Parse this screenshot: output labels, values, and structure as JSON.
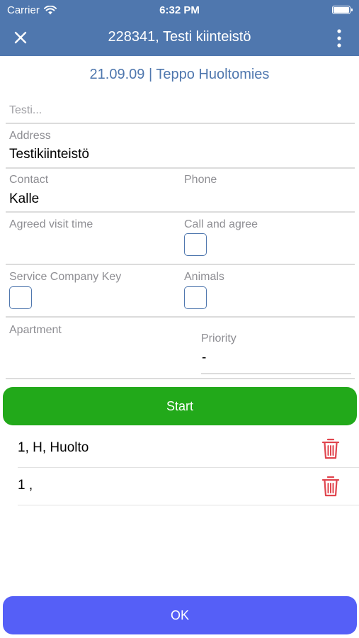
{
  "status_bar": {
    "carrier": "Carrier",
    "time": "6:32 PM"
  },
  "nav": {
    "title": "228341, Testi kiinteistö"
  },
  "subheader": "21.09.09 | Teppo Huoltomies",
  "form": {
    "description_placeholder": "Testi...",
    "address_label": "Address",
    "address_value": "Testikiinteistö",
    "contact_label": "Contact",
    "contact_value": "Kalle",
    "phone_label": "Phone",
    "phone_value": "",
    "agreed_visit_time_label": "Agreed visit time",
    "call_and_agree_label": "Call and agree",
    "service_company_key_label": "Service Company Key",
    "animals_label": "Animals",
    "apartment_label": "Apartment",
    "priority_label": "Priority",
    "priority_value": "-"
  },
  "start_label": "Start",
  "tasks": [
    {
      "text": "1, H, Huolto"
    },
    {
      "text": "1 ,"
    }
  ],
  "ok_label": "OK",
  "colors": {
    "header": "#4f77ae",
    "start": "#22a91a",
    "ok": "#555ff7",
    "trash": "#e0454e"
  },
  "icons": [
    "wifi-icon",
    "battery-icon",
    "close-icon",
    "more-vertical-icon",
    "trash-icon"
  ]
}
